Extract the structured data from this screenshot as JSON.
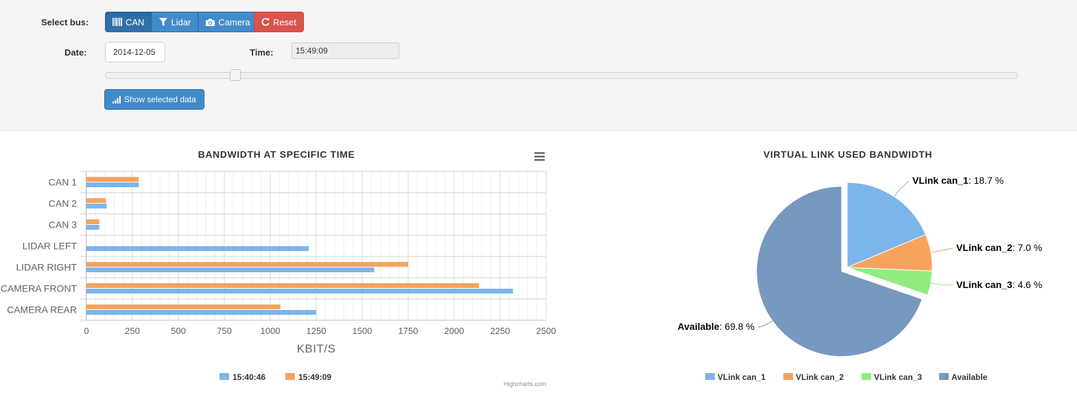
{
  "controls": {
    "bus_label": "Select bus:",
    "bus_buttons": [
      {
        "label": "CAN",
        "icon": "barcode-icon",
        "active": true
      },
      {
        "label": "Lidar",
        "icon": "filter-icon",
        "active": false
      },
      {
        "label": "Camera",
        "icon": "camera-icon",
        "active": false
      }
    ],
    "reset_label": "Reset",
    "reset_icon": "refresh-icon",
    "date_label": "Date:",
    "date_value": "2014-12-05",
    "time_label": "Time:",
    "time_value": "15:49:09",
    "slider_position": 0.142,
    "show_label": "Show selected data",
    "show_icon": "signal-icon"
  },
  "colors": {
    "primary": "#428bca",
    "danger": "#d9534f",
    "series1": "#7cb5ec",
    "series2": "#f7a35c",
    "series3": "#90ed7d",
    "series4": "#7798bf"
  },
  "chart_data": [
    {
      "type": "bar",
      "title": "BANDWIDTH AT SPECIFIC TIME",
      "xlabel": "KBIT/S",
      "categories": [
        "CAN 1",
        "CAN 2",
        "CAN 3",
        "LIDAR LEFT",
        "LIDAR RIGHT",
        "CAMERA FRONT",
        "CAMERA REAR"
      ],
      "series": [
        {
          "name": "15:40:46",
          "color": "#7cb5ec",
          "values": [
            285,
            110,
            70,
            1210,
            1565,
            2320,
            1250
          ]
        },
        {
          "name": "15:49:09",
          "color": "#f7a35c",
          "values": [
            285,
            105,
            70,
            null,
            1750,
            2135,
            1055
          ]
        }
      ],
      "xlim": [
        0,
        2500
      ],
      "xticks": [
        0,
        250,
        500,
        750,
        1000,
        1250,
        1500,
        1750,
        2000,
        2250,
        2500
      ],
      "grid": true,
      "legend": "bottom-center",
      "menu_icon": "hamburger-menu-icon",
      "credits": "Highcharts.com"
    },
    {
      "type": "pie",
      "title": "VIRTUAL LINK USED BANDWIDTH",
      "slices": [
        {
          "name": "VLink can_1",
          "value": 18.7,
          "label": ": 18.7 %",
          "color": "#7cb5ec",
          "sliced": false
        },
        {
          "name": "VLink can_2",
          "value": 7.0,
          "label": ": 7.0 %",
          "color": "#f7a35c",
          "sliced": false
        },
        {
          "name": "VLink can_3",
          "value": 4.6,
          "label": ": 4.6 %",
          "color": "#90ed7d",
          "sliced": false
        },
        {
          "name": "Available",
          "value": 69.8,
          "label": ": 69.8 %",
          "color": "#7798bf",
          "sliced": true
        }
      ],
      "legend": "bottom-center"
    }
  ]
}
